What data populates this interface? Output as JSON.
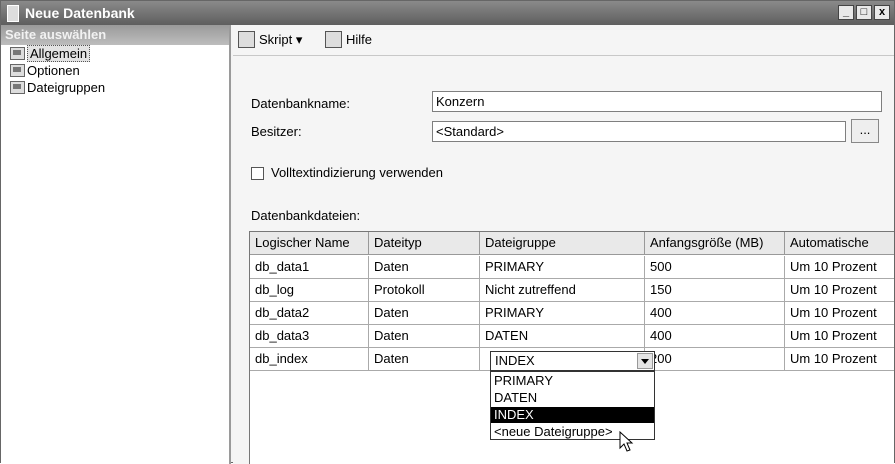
{
  "window": {
    "title": "Neue Datenbank",
    "minimize": "_",
    "maximize": "□",
    "close": "x"
  },
  "sidebar": {
    "header": "Seite auswählen",
    "items": [
      {
        "label": "Allgemein",
        "selected": true
      },
      {
        "label": "Optionen",
        "selected": false
      },
      {
        "label": "Dateigruppen",
        "selected": false
      }
    ]
  },
  "toolbar": {
    "script_label": "Skript",
    "script_arrow": "▾",
    "help_label": "Hilfe"
  },
  "form": {
    "dbname_label": "Datenbankname:",
    "dbname_value": "Konzern",
    "owner_label": "Besitzer:",
    "owner_value": "<Standard>",
    "browse_label": "...",
    "fulltext_label": "Volltextindizierung verwenden",
    "fulltext_checked": false,
    "files_label": "Datenbankdateien:"
  },
  "grid": {
    "headers": [
      "Logischer Name",
      "Dateityp",
      "Dateigruppe",
      "Anfangsgröße (MB)",
      "Automatische"
    ],
    "rows": [
      [
        "db_data1",
        "Daten",
        "PRIMARY",
        "500",
        "Um 10 Prozent"
      ],
      [
        "db_log",
        "Protokoll",
        "Nicht zutreffend",
        "150",
        "Um 10 Prozent"
      ],
      [
        "db_data2",
        "Daten",
        "PRIMARY",
        "400",
        "Um 10 Prozent"
      ],
      [
        "db_data3",
        "Daten",
        "DATEN",
        "400",
        "Um 10 Prozent"
      ],
      [
        "db_index",
        "Daten",
        "INDEX",
        "200",
        "Um 10 Prozent"
      ]
    ]
  },
  "dropdown": {
    "selected": "INDEX",
    "options": [
      "PRIMARY",
      "DATEN",
      "INDEX",
      "<neue Dateigruppe>"
    ],
    "highlighted_index": 2
  }
}
